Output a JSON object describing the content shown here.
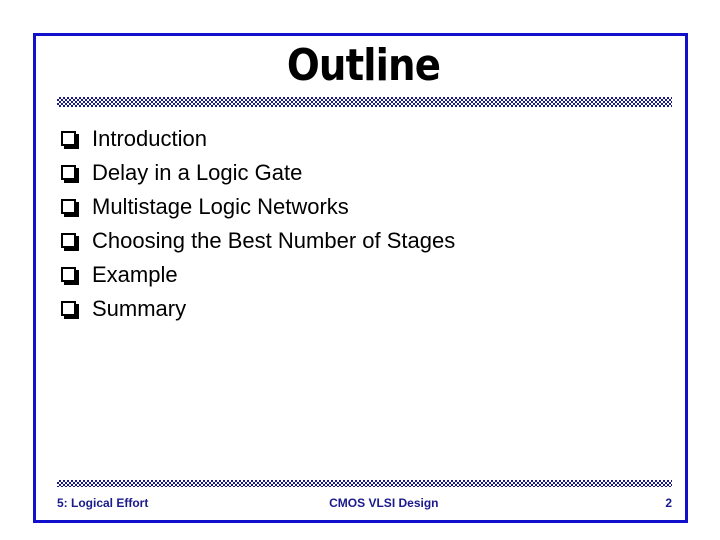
{
  "slide": {
    "title": "Outline",
    "border_color": "#1111CC",
    "background_color": "#FFFFFF",
    "accent_color": "#1A1A8C",
    "text_color": "#000000"
  },
  "content": {
    "bullet_glyph": "hollow-square-shadow",
    "items": [
      {
        "label": "Introduction"
      },
      {
        "label": "Delay in a Logic Gate"
      },
      {
        "label": "Multistage Logic Networks"
      },
      {
        "label": "Choosing the Best Number of Stages"
      },
      {
        "label": "Example"
      },
      {
        "label": "Summary"
      }
    ]
  },
  "footer": {
    "left": "5: Logical Effort",
    "center": "CMOS VLSI Design",
    "page_number": "2"
  }
}
